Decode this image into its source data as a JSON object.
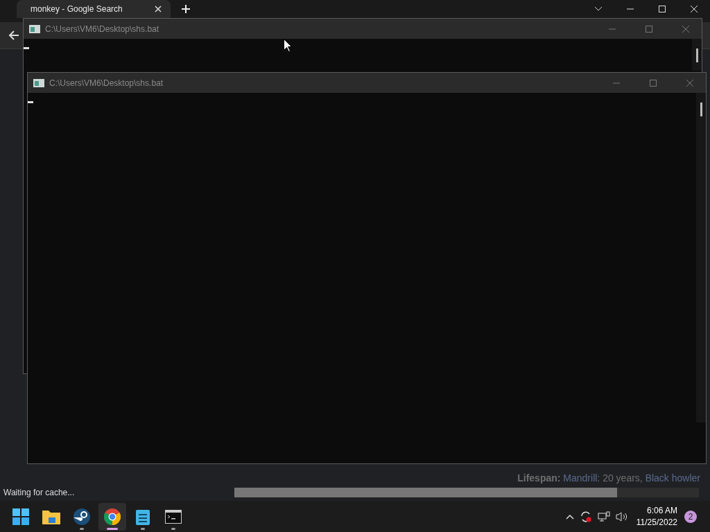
{
  "browser": {
    "tabs": [
      {
        "title": "monkey - Google Search",
        "selected": true
      }
    ],
    "lifespan": [
      {
        "kind": "label",
        "text": "Lifespan:"
      },
      {
        "kind": "link",
        "text": "Mandrill"
      },
      {
        "kind": "text",
        "text": ": 20 years,"
      },
      {
        "kind": "link",
        "text": "Black howler"
      }
    ],
    "status": "Waiting for cache..."
  },
  "consoles": [
    {
      "title": "C:\\Users\\VM6\\Desktop\\shs.bat"
    },
    {
      "title": "C:\\Users\\VM6\\Desktop\\shs.bat"
    }
  ],
  "taskbar": {
    "apps": [
      {
        "kind": "start",
        "running": false,
        "selected": false
      },
      {
        "kind": "folder",
        "running": false,
        "selected": false
      },
      {
        "kind": "steam",
        "running": true,
        "selected": false
      },
      {
        "kind": "chrome",
        "running": true,
        "selected": true
      },
      {
        "kind": "notepad",
        "running": true,
        "selected": false
      },
      {
        "kind": "terminal",
        "running": true,
        "selected": false
      }
    ],
    "time": "6:06 AM",
    "date": "11/25/2022",
    "notifications": "2"
  }
}
